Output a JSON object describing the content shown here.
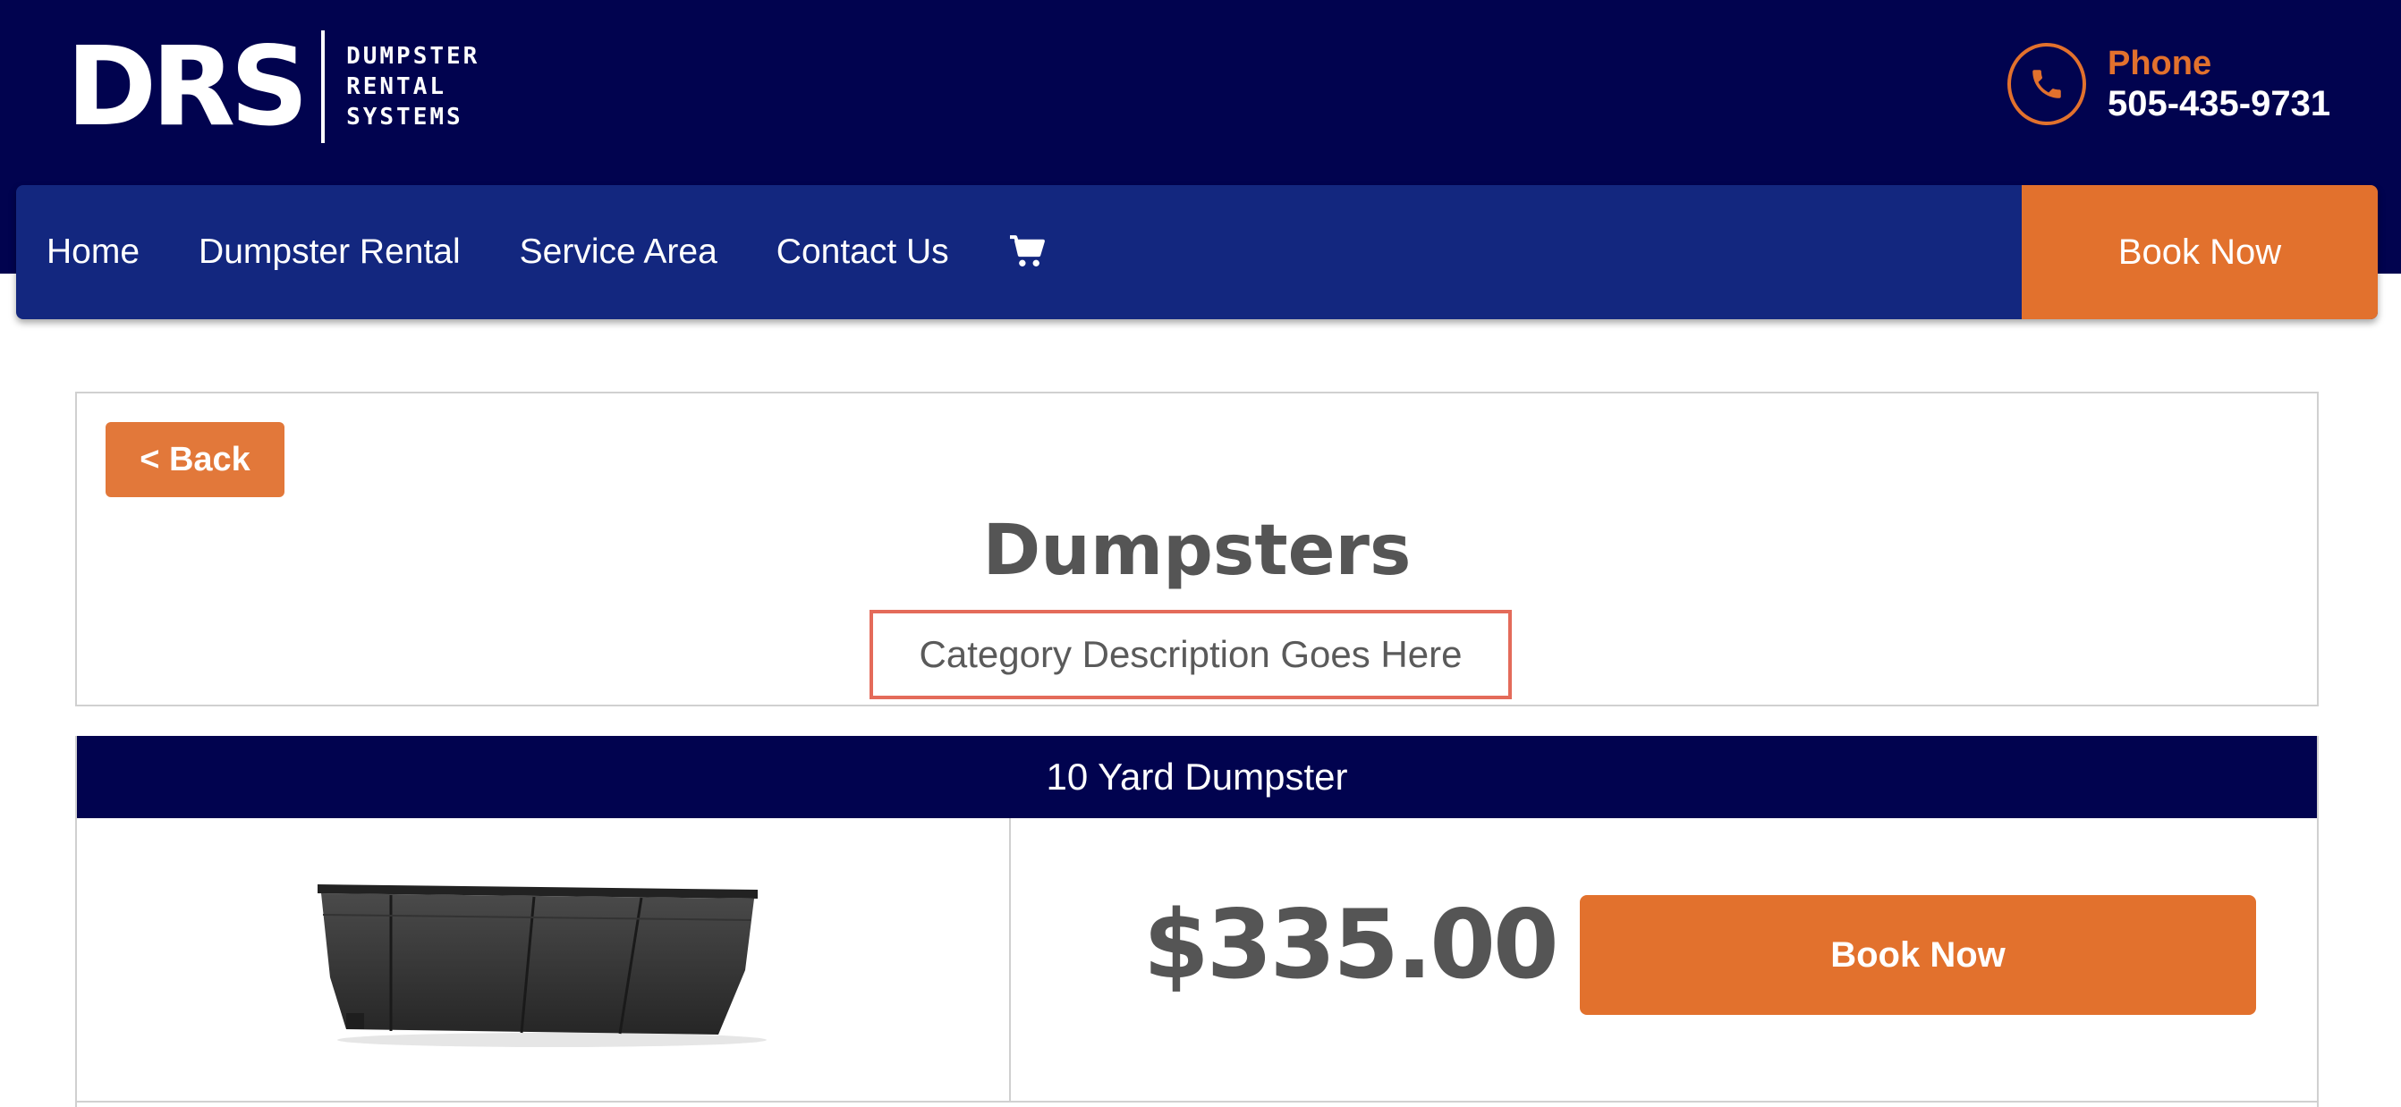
{
  "header": {
    "logo": {
      "mark": "DRS",
      "words": [
        "DUMPSTER",
        "RENTAL",
        "SYSTEMS"
      ]
    },
    "phone": {
      "label": "Phone",
      "number": "505-435-9731"
    }
  },
  "nav": {
    "items": [
      "Home",
      "Dumpster Rental",
      "Service Area",
      "Contact Us"
    ],
    "cart_icon": "shopping-cart-icon",
    "book_now": "Book Now"
  },
  "category": {
    "back_label": "< Back",
    "title": "Dumpsters",
    "description": "Category Description Goes Here"
  },
  "product": {
    "name": "10 Yard Dumpster",
    "price": "$335.00",
    "book_label": "Book Now"
  },
  "colors": {
    "navy": "#01034f",
    "nav_blue": "#13277f",
    "accent_orange": "#e2712d",
    "highlight_red": "#e46b5a"
  }
}
